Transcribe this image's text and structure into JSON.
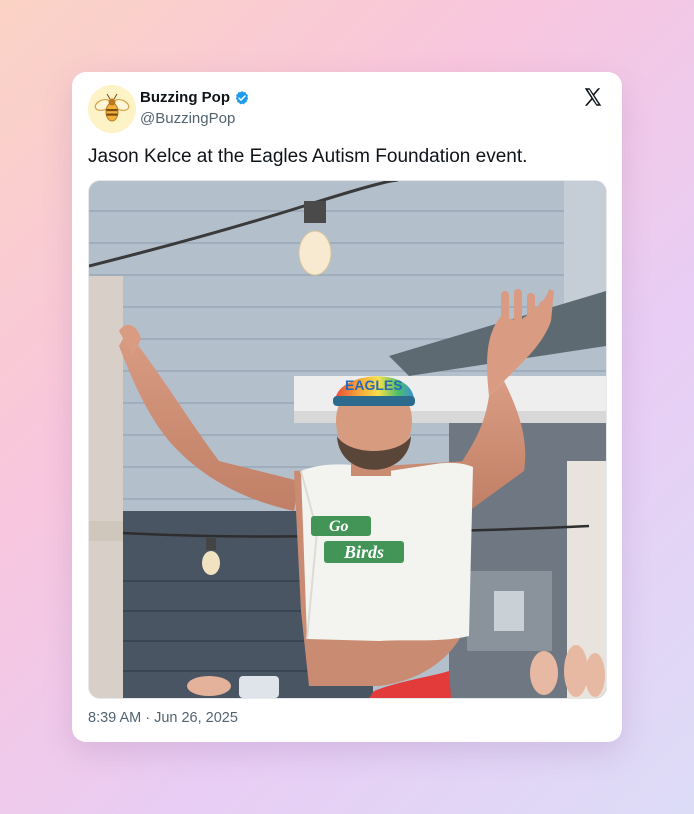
{
  "post": {
    "author_name": "Buzzing Pop",
    "author_handle": "@BuzzingPop",
    "verified": true,
    "text": "Jason Kelce at the Eagles Autism Foundation event.",
    "timestamp": "8:39 AM · Jun 26, 2025"
  },
  "icons": {
    "avatar": "bee-logo-icon",
    "verified": "verified-badge-icon",
    "platform": "x-logo-icon"
  },
  "photo": {
    "cap_text": "EAGLES",
    "shirt_text_line1": "Go",
    "shirt_text_line2": "Birds"
  },
  "colors": {
    "verified_blue": "#1d9bf0",
    "text_primary": "#0f1419",
    "text_secondary": "#536471"
  }
}
